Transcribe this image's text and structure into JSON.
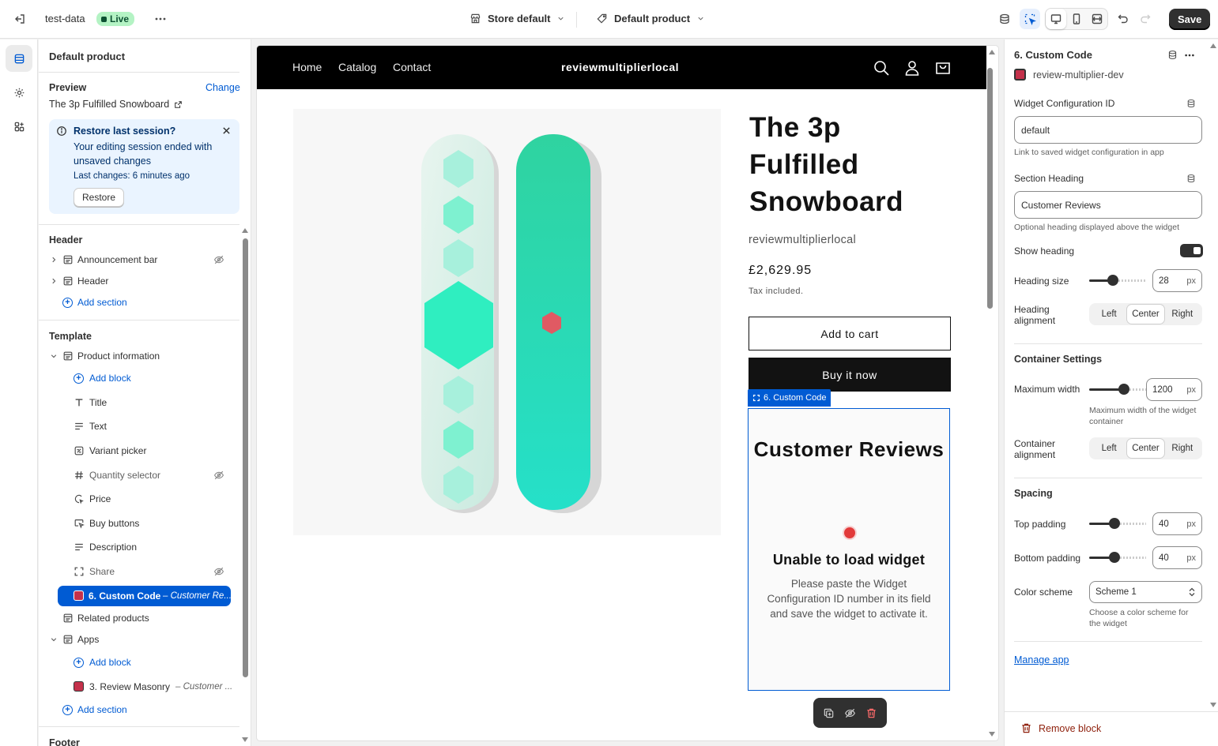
{
  "topbar": {
    "store_name": "test-data",
    "live_badge": "Live",
    "store_selector": "Store default",
    "template_selector": "Default product",
    "save_label": "Save"
  },
  "left": {
    "panel_title": "Default product",
    "preview_label": "Preview",
    "change_link": "Change",
    "preview_product": "The 3p Fulfilled Snowboard",
    "banner": {
      "title": "Restore last session?",
      "body_line1": "Your editing session ended with",
      "body_line2": "unsaved changes",
      "last_changes": "Last changes: 6 minutes ago",
      "restore_button": "Restore"
    },
    "header_group": "Header",
    "header_items": [
      "Announcement bar",
      "Header"
    ],
    "add_section": "Add section",
    "template_group": "Template",
    "product_info": "Product information",
    "add_block": "Add block",
    "blocks": [
      "Title",
      "Text",
      "Variant picker",
      "Quantity selector",
      "Price",
      "Buy buttons",
      "Description",
      "Share"
    ],
    "selected_block": "6. Custom Code",
    "selected_block_suffix": "– Customer Re...",
    "related_products": "Related products",
    "apps": "Apps",
    "app_block": "3. Review Masonry",
    "app_block_suffix": "– Customer ...",
    "footer_group": "Footer"
  },
  "preview": {
    "nav": [
      "Home",
      "Catalog",
      "Contact"
    ],
    "brand": "reviewmultiplierlocal",
    "product_title_lines": [
      "The 3p",
      "Fulfilled",
      "Snowboard"
    ],
    "vendor": "reviewmultiplierlocal",
    "price": "£2,629.95",
    "tax_note": "Tax included.",
    "add_to_cart": "Add to cart",
    "buy_now": "Buy it now",
    "block_tag": "6. Custom Code",
    "widget_heading": "Customer Reviews",
    "error_title": "Unable to load widget",
    "error_lines": [
      "Please paste the Widget",
      "Configuration ID number in its field",
      "and save the widget to activate it."
    ]
  },
  "right": {
    "title": "6. Custom Code",
    "app_name": "review-multiplier-dev",
    "widget_config_label": "Widget Configuration ID",
    "widget_config_value": "default",
    "widget_config_help": "Link to saved widget configuration in app",
    "section_heading_label": "Section Heading",
    "section_heading_value": "Customer Reviews",
    "section_heading_help": "Optional heading displayed above the widget",
    "show_heading_label": "Show heading",
    "show_heading_on": true,
    "heading_size_label": "Heading size",
    "heading_size_value": "28",
    "heading_size_level": 0.4,
    "unit_px": "px",
    "heading_alignment_label_1": "Heading",
    "heading_alignment_label_2": "alignment",
    "align_options": [
      "Left",
      "Center",
      "Right"
    ],
    "align_selected": "Center",
    "container_settings": "Container Settings",
    "max_width_label": "Maximum width",
    "max_width_value": "1200",
    "max_width_level": 0.63,
    "max_width_help_1": "Maximum width of the widget",
    "max_width_help_2": "container",
    "container_alignment_label_1": "Container",
    "container_alignment_label_2": "alignment",
    "spacing": "Spacing",
    "top_padding_label": "Top padding",
    "top_padding_value": "40",
    "top_padding_level": 0.43,
    "bottom_padding_label": "Bottom padding",
    "bottom_padding_value": "40",
    "bottom_padding_level": 0.43,
    "color_scheme_label": "Color scheme",
    "color_scheme_value": "Scheme 1",
    "color_scheme_help_1": "Choose a color scheme for",
    "color_scheme_help_2": "the widget",
    "manage_app": "Manage app",
    "remove_block": "Remove block"
  },
  "colors": {
    "accent": "#005bd3",
    "live_bg": "#b4f3c4",
    "danger": "#8e1f0b",
    "board_teal": "#2fd3a8"
  }
}
